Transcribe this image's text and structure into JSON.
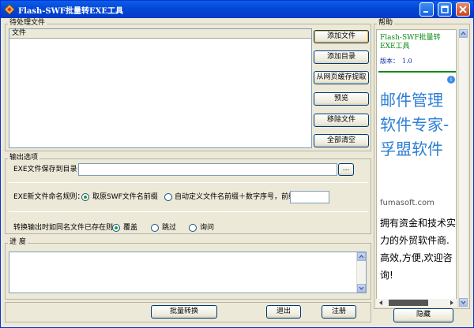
{
  "window": {
    "title": "Flash-SWF批量转EXE工具"
  },
  "files_group": {
    "label": "待处理文件",
    "column_header": "文件",
    "buttons": [
      "添加文件",
      "添加目录",
      "从网页缓存提取",
      "预览",
      "移除文件",
      "全部清空"
    ]
  },
  "output_group": {
    "label": "输出选项",
    "save_dir_label": "EXE文件保存到目录：",
    "save_dir_value": "",
    "browse_label": "...",
    "naming_label": "EXE新文件命名规则：",
    "naming_options": [
      {
        "label": "取原SWF文件名前缀",
        "selected": true
      },
      {
        "label": "自动定义文件名前缀＋数字序号，前缀：",
        "selected": false
      }
    ],
    "prefix_value": "",
    "exists_label": "转换输出时如同名文件已存在则：",
    "exists_options": [
      {
        "label": "覆盖",
        "selected": true
      },
      {
        "label": "跳过",
        "selected": false
      },
      {
        "label": "询问",
        "selected": false
      }
    ]
  },
  "progress_group": {
    "label": "进  度"
  },
  "footer_buttons": {
    "convert": "批量转换",
    "exit": "退出",
    "register": "注册"
  },
  "help": {
    "group_label": "帮助",
    "title": "Flash-SWF批量转EXE工具",
    "version_label": "版本：",
    "version_value": "1.0",
    "ad": {
      "badge": "i",
      "headline": "邮件管理软件专家-孚盟软件",
      "domain": "fumasoft.com",
      "body": "拥有资金和技术实力的外贸软件商.高效,方便,欢迎咨询!"
    },
    "hide_button": "隐藏"
  }
}
